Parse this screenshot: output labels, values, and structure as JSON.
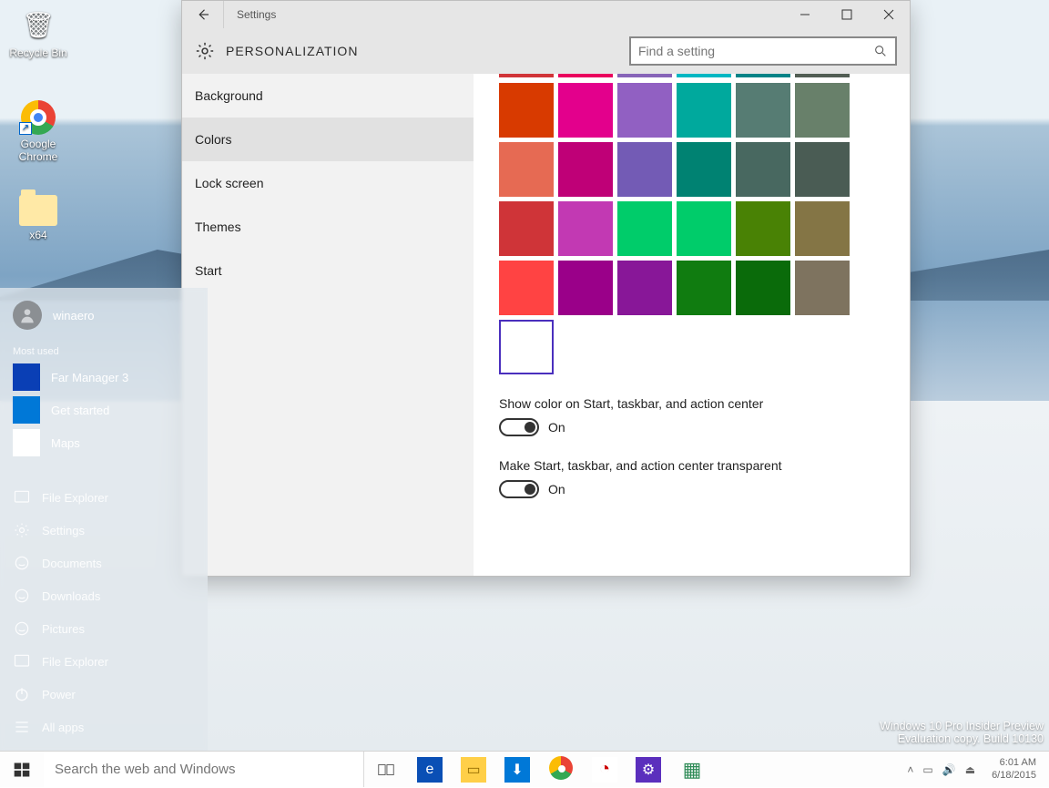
{
  "desktop_icons": {
    "recycle": "Recycle Bin",
    "chrome": "Google Chrome",
    "x64": "x64"
  },
  "settings": {
    "title": "Settings",
    "header": "PERSONALIZATION",
    "search_placeholder": "Find a setting",
    "nav": [
      "Background",
      "Colors",
      "Lock screen",
      "Themes",
      "Start"
    ],
    "nav_selected_index": 1,
    "color_rows": [
      [
        "#d83a00",
        "#e3008c",
        "#9160c2",
        "#00a99d",
        "#567c73",
        "#68806a"
      ],
      [
        "#e66a53",
        "#bf0077",
        "#735bb5",
        "#008272",
        "#486860",
        "#4a5c54"
      ],
      [
        "#cf3438",
        "#c239b3",
        "#00cc6a",
        "#00cc6a",
        "#498205",
        "#847545"
      ],
      [
        "#ff4343",
        "#9a0089",
        "#881798",
        "#107c10",
        "#0a6b0a",
        "#7e735f"
      ]
    ],
    "peek_row": [
      "#d13438",
      "#ea005e",
      "#8764b8",
      "#00b7c3",
      "#038387",
      "#525e54"
    ],
    "has_extra_white_swatch": true,
    "show_color_label": "Show color on Start, taskbar, and action center",
    "show_color_value": "On",
    "transparent_label": "Make Start, taskbar, and action center transparent",
    "transparent_value": "On"
  },
  "start": {
    "username": "winaero",
    "most_used_label": "Most used",
    "most_used": [
      {
        "label": "Far Manager 3",
        "bg": "#0a3fb5"
      },
      {
        "label": "Get started",
        "bg": "#0078d7"
      },
      {
        "label": "Maps",
        "bg": "#ffffff"
      }
    ],
    "lower": [
      "File Explorer",
      "Settings",
      "Documents",
      "Downloads",
      "Pictures",
      "File Explorer",
      "Power",
      "All apps"
    ]
  },
  "taskbar": {
    "search_placeholder": "Search the web and Windows"
  },
  "watermark": {
    "line1": "Windows 10 Pro Insider Preview",
    "line2": "Evaluation copy. Build 10130"
  },
  "tray": {
    "time": "6:01 AM",
    "date": "6/18/2015"
  }
}
